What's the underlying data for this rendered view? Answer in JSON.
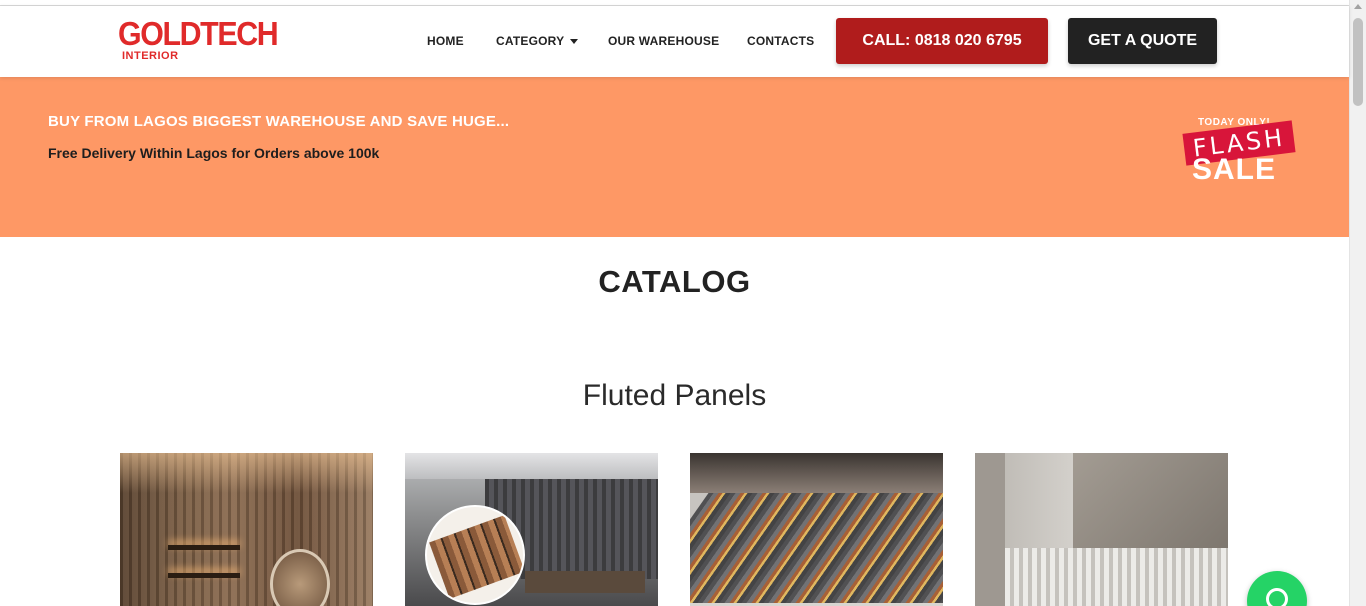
{
  "header": {
    "logo": {
      "main": "GOLDTECH",
      "sub": "INTERIOR"
    },
    "nav": [
      {
        "label": "HOME"
      },
      {
        "label": "CATEGORY"
      },
      {
        "label": "OUR WAREHOUSE"
      },
      {
        "label": "CONTACTS"
      }
    ],
    "call_button": "CALL: 0818 020 6795",
    "quote_button": "GET A QUOTE"
  },
  "banner": {
    "title": "BUY FROM LAGOS BIGGEST WAREHOUSE AND SAVE HUGE...",
    "subtitle": "Free Delivery Within Lagos for Orders above 100k",
    "badge": {
      "top": "TODAY ONLY!",
      "flash": "FLASH",
      "sale": "SALE"
    }
  },
  "main": {
    "catalog_title": "CATALOG",
    "section_title": "Fluted Panels",
    "products": [
      {
        "icon": "fluted-panel-wall-image"
      },
      {
        "icon": "fluted-panel-office-image"
      },
      {
        "icon": "fluted-panel-stack-image"
      },
      {
        "icon": "fluted-panel-interior-image"
      }
    ]
  },
  "colors": {
    "brand_red": "#e02a2a",
    "call_button": "#b01c1c",
    "quote_button": "#222222",
    "banner_bg": "#fe9865",
    "flash_red": "#d8153a",
    "whatsapp_green": "#25d366"
  },
  "floating": {
    "icon": "whatsapp-icon"
  }
}
